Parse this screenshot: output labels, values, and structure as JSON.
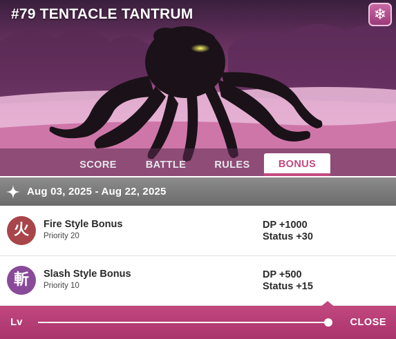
{
  "event": {
    "title": "#79 TENTACLE TANTRUM",
    "badge_icon": "snowflake-icon"
  },
  "tabs": [
    {
      "label": "SCORE",
      "active": false
    },
    {
      "label": "BATTLE",
      "active": false
    },
    {
      "label": "RULES",
      "active": false
    },
    {
      "label": "BONUS",
      "active": true
    }
  ],
  "period": {
    "icon": "sparkle-icon",
    "dates": "Aug 03, 2025 - Aug 22, 2025"
  },
  "bonuses": [
    {
      "glyph": "火",
      "icon": "fire-style-icon",
      "name": "Fire Style Bonus",
      "priority": "Priority 20",
      "dp": "DP +1000",
      "status": "Status +30",
      "color": "#a8454a"
    },
    {
      "glyph": "斬",
      "icon": "slash-style-icon",
      "name": "Slash Style Bonus",
      "priority": "Priority 10",
      "dp": "DP +500",
      "status": "Status +15",
      "color": "#8a4a9a"
    }
  ],
  "footer": {
    "lv_label": "Lv",
    "slider_level": 1.0,
    "close_label": "CLOSE"
  },
  "colors": {
    "accent": "#c2497f",
    "date_bar": "#7a7a7a"
  }
}
